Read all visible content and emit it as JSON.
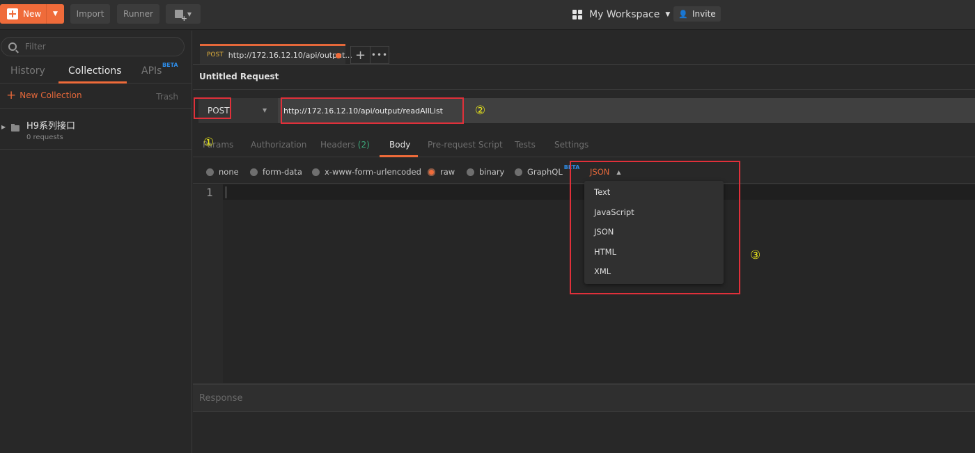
{
  "topbar": {
    "new_label": "New",
    "import_label": "Import",
    "runner_label": "Runner",
    "workspace_label": "My Workspace",
    "invite_label": "Invite"
  },
  "sidebar": {
    "filter_placeholder": "Filter",
    "tabs": [
      {
        "label": "History",
        "active": false
      },
      {
        "label": "Collections",
        "active": true
      },
      {
        "label": "APIs",
        "badge": "BETA",
        "active": false
      }
    ],
    "new_collection_label": "New Collection",
    "trash_label": "Trash",
    "collections": [
      {
        "name": "H9系列接口",
        "subtitle": "0 requests"
      }
    ]
  },
  "request_tab": {
    "method": "POST",
    "title": "http://172.16.12.10/api/output...",
    "unsaved": true,
    "add_label": "+",
    "more_label": "•••"
  },
  "request": {
    "title": "Untitled Request",
    "method": "POST",
    "url": "http://172.16.12.10/api/output/readAllList"
  },
  "subtabs": [
    {
      "label": "Params"
    },
    {
      "label": "Authorization"
    },
    {
      "label": "Headers",
      "count": "(2)"
    },
    {
      "label": "Body",
      "active": true
    },
    {
      "label": "Pre-request Script"
    },
    {
      "label": "Tests"
    },
    {
      "label": "Settings"
    }
  ],
  "body": {
    "options": [
      {
        "label": "none",
        "selected": false
      },
      {
        "label": "form-data",
        "selected": false
      },
      {
        "label": "x-www-form-urlencoded",
        "selected": false
      },
      {
        "label": "raw",
        "selected": true
      },
      {
        "label": "binary",
        "selected": false
      },
      {
        "label": "GraphQL",
        "badge": "BETA",
        "selected": false
      }
    ],
    "language": "JSON",
    "language_options": [
      "Text",
      "JavaScript",
      "JSON",
      "HTML",
      "XML"
    ],
    "editor_line": "1"
  },
  "response": {
    "label": "Response"
  },
  "annotations": {
    "one": "①",
    "two": "②",
    "three": "③",
    "box_color": "#e0303a",
    "number_color": "#e6e31b"
  },
  "colors": {
    "accent": "#ef6b3a",
    "beta": "#2d8ce8",
    "method_post": "#e4b23c"
  }
}
